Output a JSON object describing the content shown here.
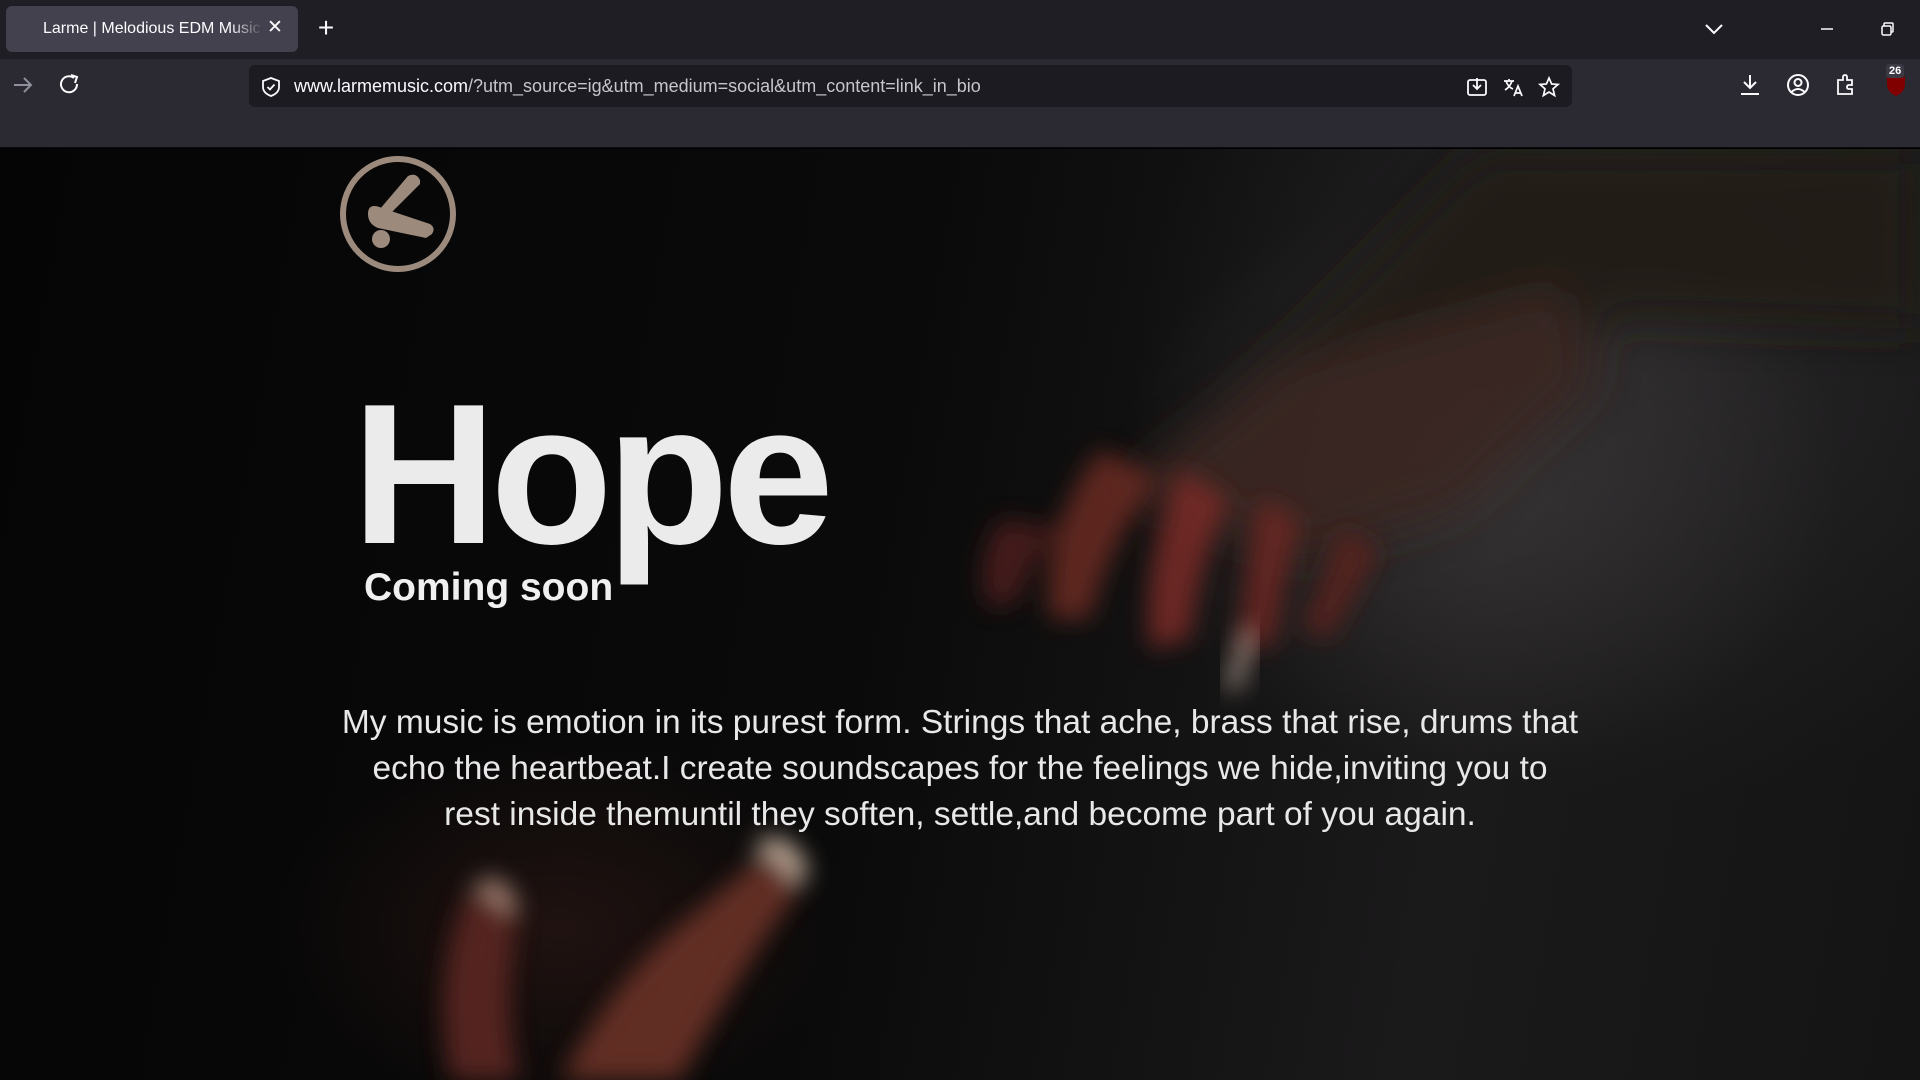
{
  "browser": {
    "tab": {
      "title": "Larme | Melodious EDM Music Of"
    },
    "url": {
      "domain": "www.larmemusic.com",
      "path": "/?utm_source=ig&utm_medium=social&utm_content=link_in_bio"
    },
    "extension_badge": "26",
    "icons": [
      "forward-icon",
      "reload-icon",
      "shield-icon",
      "download-page-icon",
      "translate-icon",
      "star-icon",
      "download-icon",
      "account-icon",
      "extensions-icon",
      "ublock-icon"
    ]
  },
  "page": {
    "headline": "Hope",
    "subheadline": "Coming soon",
    "description": "My music is emotion in its purest form. Strings that ache, brass that rise, drums that echo the heartbeat.I create soundscapes for the feelings we hide,inviting you to rest inside themuntil they soften, settle,and become part of you again."
  },
  "colors": {
    "accent_logo": "#9c8a7d",
    "headline": "#ebebeb",
    "chrome_tab": "#42414d",
    "chrome_bg": "#2b2a33"
  }
}
